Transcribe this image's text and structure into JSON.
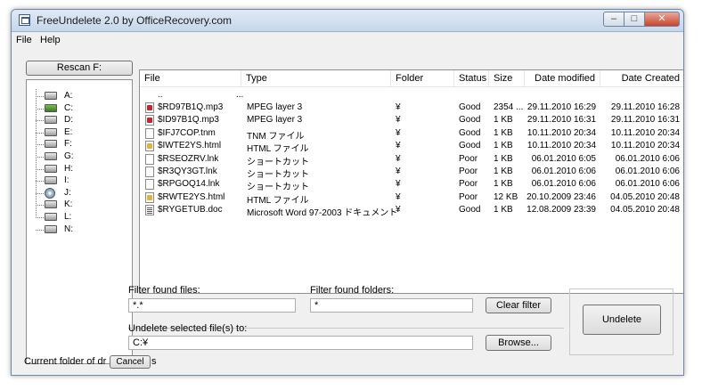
{
  "window": {
    "title": "FreeUndelete 2.0 by OfficeRecovery.com",
    "min_glyph": "–",
    "max_glyph": "□",
    "close_glyph": "✕"
  },
  "menu": {
    "items": [
      "File",
      "Help"
    ]
  },
  "rescan_button": "Rescan F:",
  "tree": {
    "drives": [
      {
        "label": "A:",
        "icon": "floppy-drive-icon"
      },
      {
        "label": "C:",
        "icon": "system-drive-icon"
      },
      {
        "label": "D:",
        "icon": "hard-drive-icon"
      },
      {
        "label": "E:",
        "icon": "hard-drive-icon"
      },
      {
        "label": "F:",
        "icon": "hard-drive-icon"
      },
      {
        "label": "G:",
        "icon": "hard-drive-icon"
      },
      {
        "label": "H:",
        "icon": "hard-drive-icon"
      },
      {
        "label": "I:",
        "icon": "hard-drive-icon"
      },
      {
        "label": "J:",
        "icon": "cd-drive-icon"
      },
      {
        "label": "K:",
        "icon": "hard-drive-icon"
      },
      {
        "label": "L:",
        "icon": "hard-drive-icon"
      },
      {
        "label": "N:",
        "icon": "hard-drive-icon"
      }
    ]
  },
  "list": {
    "columns": {
      "file": "File",
      "type": "Type",
      "folder": "Folder",
      "status": "Status",
      "size": "Size",
      "modified": "Date modified",
      "created": "Date Created"
    },
    "parent_row": {
      "file": "..",
      "type": "..."
    },
    "rows": [
      {
        "icon": "mp3",
        "file": "$RD97B1Q.mp3",
        "type": "MPEG layer 3",
        "folder": "¥",
        "status": "Good",
        "size": "2354 ...",
        "modified": "29.11.2010 16:29",
        "created": "29.11.2010 16:28"
      },
      {
        "icon": "mp3",
        "file": "$ID97B1Q.mp3",
        "type": "MPEG layer 3",
        "folder": "¥",
        "status": "Good",
        "size": "1 KB",
        "modified": "29.11.2010 16:31",
        "created": "29.11.2010 16:31"
      },
      {
        "icon": "blank",
        "file": "$IFJ7COP.tnm",
        "type": "TNM ファイル",
        "folder": "¥",
        "status": "Good",
        "size": "1 KB",
        "modified": "10.11.2010 20:34",
        "created": "10.11.2010 20:34"
      },
      {
        "icon": "html",
        "file": "$IWTE2YS.html",
        "type": "HTML ファイル",
        "folder": "¥",
        "status": "Good",
        "size": "1 KB",
        "modified": "10.11.2010 20:34",
        "created": "10.11.2010 20:34"
      },
      {
        "icon": "blank",
        "file": "$RSEOZRV.lnk",
        "type": "ショートカット",
        "folder": "¥",
        "status": "Poor",
        "size": "1 KB",
        "modified": "06.01.2010 6:05",
        "created": "06.01.2010 6:06"
      },
      {
        "icon": "blank",
        "file": "$R3QY3GT.lnk",
        "type": "ショートカット",
        "folder": "¥",
        "status": "Poor",
        "size": "1 KB",
        "modified": "06.01.2010 6:06",
        "created": "06.01.2010 6:06"
      },
      {
        "icon": "blank",
        "file": "$RPGOQ14.lnk",
        "type": "ショートカット",
        "folder": "¥",
        "status": "Poor",
        "size": "1 KB",
        "modified": "06.01.2010 6:06",
        "created": "06.01.2010 6:06"
      },
      {
        "icon": "html",
        "file": "$RWTE2YS.html",
        "type": "HTML ファイル",
        "folder": "¥",
        "status": "Poor",
        "size": "12 KB",
        "modified": "20.10.2009 23:46",
        "created": "04.05.2010 20:48"
      },
      {
        "icon": "doc",
        "file": "$RYGETUB.doc",
        "type": "Microsoft Word 97-2003 ドキュメント",
        "folder": "¥",
        "status": "Good",
        "size": "1 KB",
        "modified": "12.08.2009 23:39",
        "created": "04.05.2010 20:48"
      }
    ]
  },
  "filters": {
    "files_label": "Filter found files:",
    "files_value": "*.*",
    "folders_label": "Filter found folders:",
    "folders_value": "*",
    "clear_button": "Clear filter"
  },
  "undelete": {
    "target_label": "Undelete selected file(s) to:",
    "target_value": "C:¥",
    "browse_button": "Browse...",
    "undelete_button": "Undelete"
  },
  "status": {
    "text": "Current folder of dr",
    "cancel_button": "Cancel",
    "trail": "s"
  }
}
